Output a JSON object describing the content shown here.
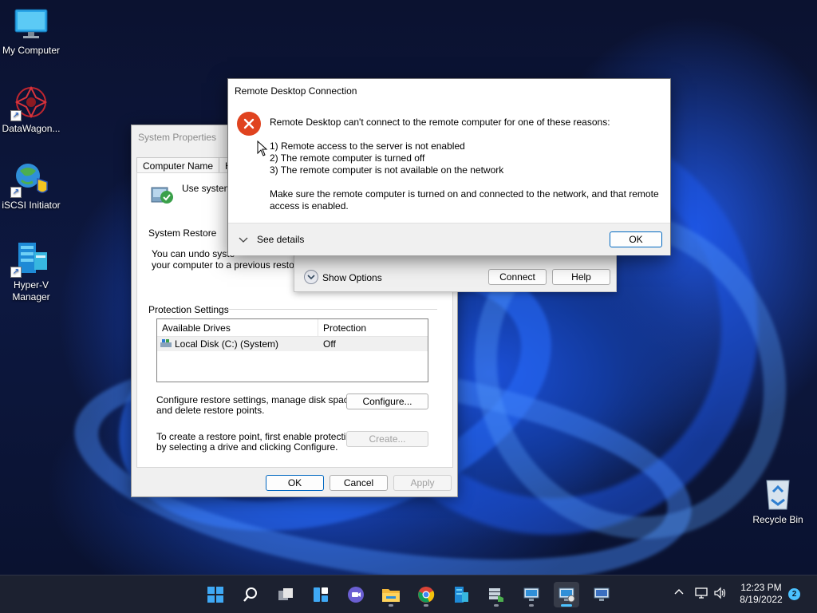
{
  "desktop": {
    "icons": [
      {
        "label": "My Computer",
        "icon": "monitor-icon"
      },
      {
        "label": "DataWagon...",
        "icon": "datawagon-icon"
      },
      {
        "label": "iSCSI Initiator",
        "icon": "iscsi-globe-icon"
      },
      {
        "label": "Hyper-V Manager",
        "icon": "hyperv-icon"
      },
      {
        "label": "Recycle Bin",
        "icon": "recycle-bin-icon"
      }
    ]
  },
  "system_properties": {
    "title": "System Properties",
    "tabs": [
      "Computer Name",
      "Hard"
    ],
    "intro_text": "Use system p",
    "restore_group": "System Restore",
    "restore_desc_1": "You can undo syste",
    "restore_desc_2": "your computer to a previous restore po",
    "protection_group": "Protection Settings",
    "columns": [
      "Available Drives",
      "Protection"
    ],
    "drives": [
      {
        "name": "Local Disk (C:) (System)",
        "protection": "Off"
      }
    ],
    "configure_text_1": "Configure restore settings, manage disk space,",
    "configure_text_2": "and delete restore points.",
    "configure_label": "Configure...",
    "create_text_1": "To create a restore point, first enable protection",
    "create_text_2": "by selecting a drive and clicking Configure.",
    "create_label": "Create...",
    "ok_label": "OK",
    "cancel_label": "Cancel",
    "apply_label": "Apply"
  },
  "rdp_window": {
    "show_options_label": "Show Options",
    "connect_label": "Connect",
    "help_label": "Help"
  },
  "error_dialog": {
    "title": "Remote Desktop Connection",
    "headline": "Remote Desktop can't connect to the remote computer for one of these reasons:",
    "reasons": [
      "1) Remote access to the server is not enabled",
      "2) The remote computer is turned off",
      "3) The remote computer is not available on the network"
    ],
    "advice_1": "Make sure the remote computer is turned on and connected to the network, and that remote",
    "advice_2": "access is enabled.",
    "see_details_label": "See details",
    "ok_label": "OK"
  },
  "taskbar": {
    "time": "12:23 PM",
    "date": "8/19/2022",
    "notification_count": "2",
    "apps": [
      "start-icon",
      "search-icon",
      "task-view-icon",
      "widgets-icon",
      "teams-chat-icon",
      "file-explorer-icon",
      "chrome-icon",
      "hyperv-taskbar-icon",
      "server-manager-icon",
      "remote-desktop-icon",
      "remote-desktop-active-icon",
      "remote-desktop-2-icon"
    ]
  },
  "colors": {
    "error_red": "#e0431f",
    "accent_blue": "#0067c0",
    "taskbar_bg": "#1c2130"
  }
}
